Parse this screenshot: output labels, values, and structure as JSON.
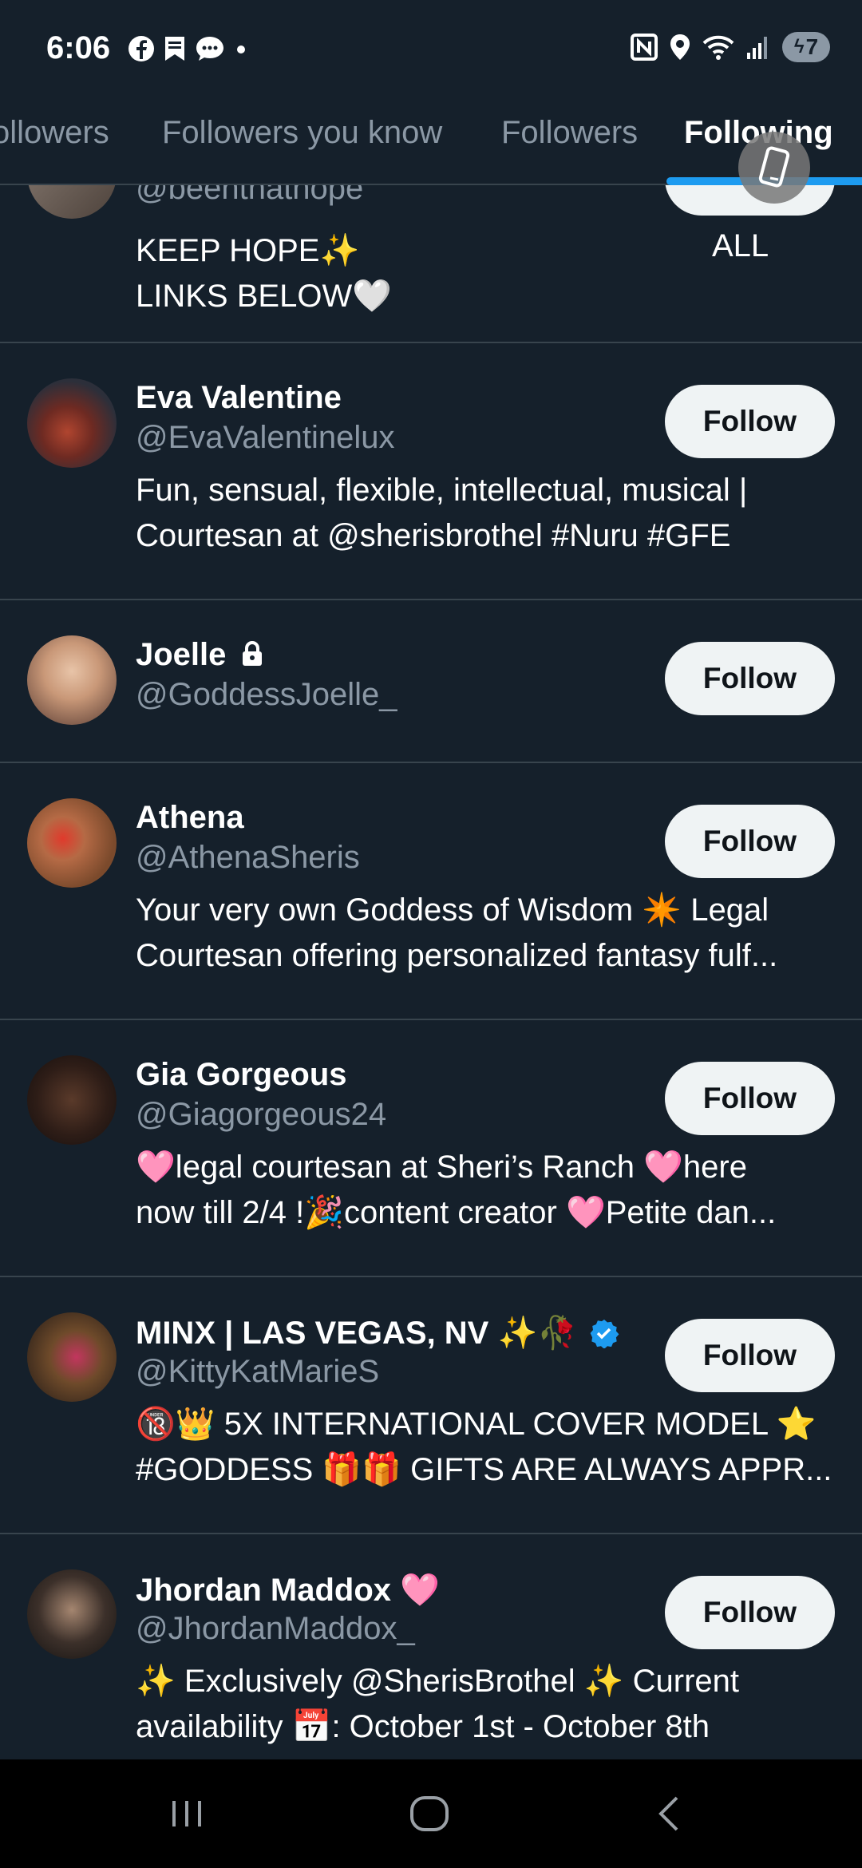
{
  "status_bar": {
    "time": "6:06",
    "battery": "7",
    "left_icons": [
      "facebook-icon",
      "bookmark-icon",
      "chat-icon",
      "dot-icon"
    ],
    "right_icons": [
      "nfc-icon",
      "location-icon",
      "wifi-icon",
      "signal-icon",
      "battery-icon"
    ]
  },
  "tabs": [
    "ollowers",
    "Followers you know",
    "Followers",
    "Following"
  ],
  "active_tab": "Following",
  "accent_color": "#1d9bf0",
  "rows": [
    {
      "handle": "@beenthathope",
      "bio": [
        "KEEP HOPE✨",
        "LINKS BELOW🤍"
      ],
      "button_partial": "ALL"
    },
    {
      "name": "Eva Valentine",
      "handle": "@EvaValentinelux",
      "bio": [
        "Fun, sensual, flexible, intellectual, musical |",
        "Courtesan at @sherisbrothel #Nuru #GFE"
      ],
      "button": "Follow"
    },
    {
      "name": "Joelle",
      "handle": "@GoddessJoelle_",
      "bio": [],
      "button": "Follow",
      "lock": true
    },
    {
      "name": "Athena",
      "handle": "@AthenaSheris",
      "bio": [
        "Your very own Goddess of Wisdom ✴️ Legal",
        "Courtesan offering personalized fantasy fulf..."
      ],
      "button": "Follow"
    },
    {
      "name": "Gia Gorgeous",
      "handle": "@Giagorgeous24",
      "bio": [
        "🩷legal courtesan at Sheri’s Ranch 🩷here",
        "now till 2/4 !🎉content creator 🩷Petite dan..."
      ],
      "button": "Follow"
    },
    {
      "name": "MINX | LAS VEGAS, NV ✨🥀",
      "handle": "@KittyKatMarieS",
      "bio": [
        "🔞👑 5X INTERNATIONAL COVER MODEL ⭐",
        "#GODDESS 🎁🎁 GIFTS ARE ALWAYS APPR..."
      ],
      "button": "Follow",
      "verified": true
    },
    {
      "name": "Jhordan Maddox 🩷",
      "handle": "@JhordanMaddox_",
      "bio": [
        "✨ Exclusively @SherisBrothel ✨ Current",
        "availability 📅: October 1st - October 8th"
      ],
      "button": "Follow"
    }
  ],
  "nav": [
    "recents-icon",
    "home-icon",
    "back-icon"
  ]
}
